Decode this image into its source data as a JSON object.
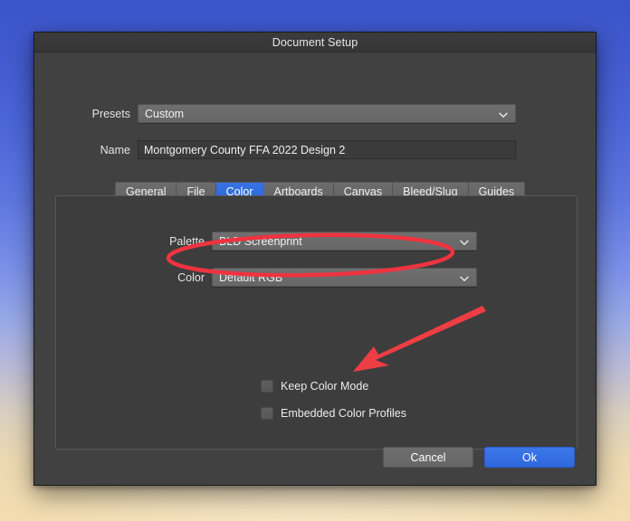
{
  "window": {
    "title": "Document Setup"
  },
  "form": {
    "presets": {
      "label": "Presets",
      "value": "Custom"
    },
    "name": {
      "label": "Name",
      "value": "Montgomery County FFA 2022 Design 2"
    }
  },
  "tabs": [
    {
      "label": "General",
      "active": false
    },
    {
      "label": "File",
      "active": false
    },
    {
      "label": "Color",
      "active": true
    },
    {
      "label": "Artboards",
      "active": false
    },
    {
      "label": "Canvas",
      "active": false
    },
    {
      "label": "Bleed/Slug",
      "active": false
    },
    {
      "label": "Guides",
      "active": false
    }
  ],
  "color_panel": {
    "palette": {
      "label": "Palette",
      "value": "BLD Screenprint"
    },
    "color": {
      "label": "Color",
      "value": "Default RGB"
    },
    "checkboxes": [
      {
        "label": "Keep Color Mode",
        "checked": false
      },
      {
        "label": "Embedded Color Profiles",
        "checked": false
      }
    ]
  },
  "footer": {
    "cancel_label": "Cancel",
    "ok_label": "Ok"
  },
  "annotations": {
    "highlight_color": "#ef3340",
    "arrow_color": "#ef3d44",
    "ellipse_target": "color-dropdown-row",
    "arrow_target": "keep-color-mode-checkbox"
  },
  "colors": {
    "accent_blue": "#2f67dd",
    "dialog_bg": "#414141",
    "titlebar_bg": "#383838",
    "panel_bg": "#3d3d3d",
    "dropdown_bg": "#6a6a6a",
    "input_bg": "#3b3b3b",
    "desktop_top": "#3a55c9",
    "desktop_bottom": "#f2dcae"
  },
  "icons": {
    "chevron_down": "chevron-down-icon"
  }
}
